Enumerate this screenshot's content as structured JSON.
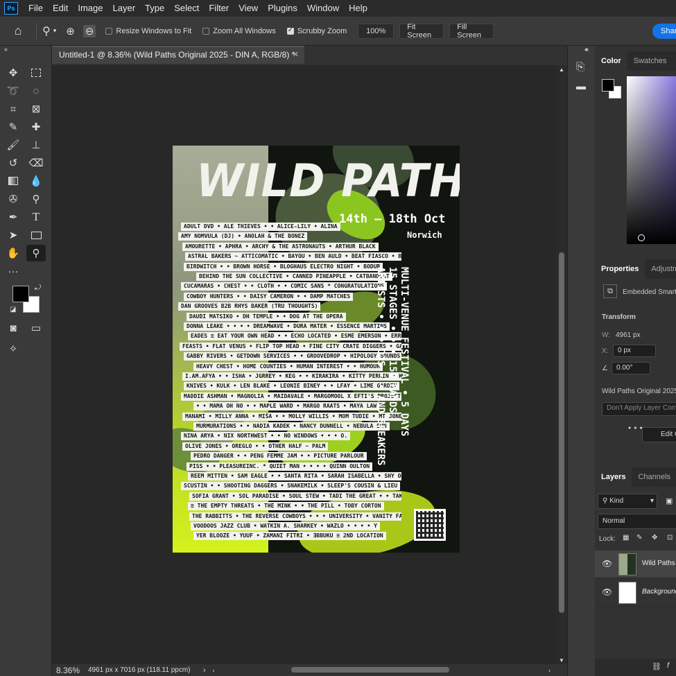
{
  "app": {
    "logo": "Ps"
  },
  "menu": [
    "File",
    "Edit",
    "Image",
    "Layer",
    "Type",
    "Select",
    "Filter",
    "View",
    "Plugins",
    "Window",
    "Help"
  ],
  "options": {
    "resize_windows": "Resize Windows to Fit",
    "zoom_all": "Zoom All Windows",
    "scrubby": "Scrubby Zoom",
    "zoom_value": "100%",
    "fit_screen": "Fit Screen",
    "fill_screen": "Fill Screen",
    "share": "Share"
  },
  "document": {
    "tab_title": "Untitled-1 @ 8.36% (Wild Paths Original 2025 - DIN A, RGB/8) *",
    "zoom": "8.36%",
    "dimensions": "4961 px x 7016 px (118.11 ppcm)"
  },
  "poster": {
    "title": "WILD PATHS",
    "dates": "14th – 18th Oct",
    "city": "Norwich",
    "side_text": "MULTI-VENUE FESTIVAL • 5 DAYS\n15 STAGES • • • 150 BANDS\nARTISTS • • • DJS • • AND SPEAKERS",
    "lineup": [
      "ADULT DVD • ALE THIEVES • • ALICE-LILY • ALINA",
      "AMY NOMVULA (DJ) • ANOLAH & THE BONEZ",
      "AMOURETTE • APHRA • ARCHY & THE ASTRONAUTS • ARTHUR BLACK",
      "ASTRAL BAKERS ~ ATTICOMATIC • BAYOU • BEN AULD • BEAT FIASCO • BINA.",
      "BIRDWITCH • • BROWN HORSE • BLOGHAUS ELECTRO NIGHT • BODUR",
      "BEHIND THE SUN COLLECTIVE • CANNED PINEAPPLE • CATBANDCAT",
      "CUCAMARAS • CHEST • • CLOTH • • COMIC SANS * CONGRATULATIONS",
      "COWBOY HUNTERS • • DAISY CAMERON • • DAMP MATCHES",
      "DAN GROOVES B2B RHYS BAKER (TRU THOUGHTS)",
      "DAUDI MATSIKO • DH TEMPLE • • DOG AT THE OPERA",
      "DONNA LEAKE • • • • DREAMWAVE • DURA MATER • ESSENCE MARTINS",
      "EADES ≡ EAT YOUR OWN HEAD • • ECHO LOCATED • ESME EMERSON • ERROL",
      "FEASTS • FLAT VENUS • FLIP TOP HEAD • FINE CITY CRATE DIGGERS • GALLUS",
      "GABBY RIVERS • GETDOWN SERVICES • • GROOVEDROP • HIPOLOGY SOUNDS",
      "HEAVY CHEST • HOME COUNTIES • HUMAN INTEREST • • HUMOUR",
      "I.AM.AFYA • • ISHA • JGRREY • KEG • • KIRAKIRA • KITTY PERRIN • KNATS",
      "KNIVES • KULK • LEN BLAKE • LEONIE BINEY • • LFAY • LIME GARDEN",
      "MADDIE ASHMAN • MAGNOLIA • MAIDAVALE • MARGOMOOL X EFTI'S PROJECT",
      "• • MAMA OH NO • • MAPLE WARD • MARGO RAATS • MAYA LAW",
      "MANAMI • MILLY ANNA • MIŠA • • MOLLY WILLIS • MOM TUDIE • MT JONES",
      "MURMURATIONS • • NADIA KADEK • NANCY DUNNELL • NEBULA SUN",
      "NINA ARYA • NIX NORTHWEST • • NO WINDOWS • • • O.",
      "OLIVE JONES • OREGLO • • OTHER HALF ~ PALM",
      "PEDRO DANGER • • PENG FEMME JAM • • PICTURE PARLOUR",
      "PISS • • PLEASUREINC. * QUIET MAN • • • • QUINN OULTON",
      "REEM MITTEN • SAM EAGLE • • SANTA RITA • SARAH ISABELLA • SHY ONE",
      "SCUSTIN • • SHOOTING DAGGERS • SNAKEMILK • SLEEP'S COUSIN & LIEU",
      "SOFIA GRANT • SOL PARADISE • SOUL STEW • TADI THE GREAT • • TAKEDA",
      "≡ THE EMPTY THREATS • THE MINK • • THE PILL • TOBY CORTON",
      "THE RABBITTS • THE REVERSE COWBOYS • • • UNIVERSITY • VANITY FAIRY",
      "VOODOOS JAZZ CLUB • WATKIN A. SHARKEY • WAZLO • • • • Y",
      "YER BLOOZE • YUUF • ZAMANI FITRI • ƎBBUKU ≡ 2ND LOCATION"
    ]
  },
  "right_panel": {
    "color_tabs": [
      "Color",
      "Swatches",
      "G"
    ],
    "props_tabs": [
      "Properties",
      "Adjustm"
    ],
    "embedded": "Embedded Smart",
    "transform_label": "Transform",
    "w_label": "W:",
    "w_value": "4961 px",
    "x_label": "X:",
    "x_value": "0 px",
    "angle": "0.00°",
    "layer_comp_name": "Wild Paths Original 2025",
    "layer_comp_dropdown": "Don't Apply Layer Com",
    "edit_btn": "Edit C",
    "layers_tabs": [
      "Layers",
      "Channels"
    ],
    "kind_filter": "Kind",
    "blend_mode": "Normal",
    "lock_label": "Lock:",
    "layers": [
      {
        "name": "Wild Paths",
        "italic": false
      },
      {
        "name": "Background",
        "italic": true
      }
    ]
  },
  "tools": [
    "move-icon",
    "marquee-icon",
    "lasso-icon",
    "quick-select-icon",
    "crop-icon",
    "frame-icon",
    "eyedropper-icon",
    "healing-icon",
    "brush-icon",
    "stamp-icon",
    "history-brush-icon",
    "eraser-icon",
    "gradient-icon",
    "blur-icon",
    "dodge-icon",
    "pen-icon",
    "type-icon",
    "path-select-icon",
    "rectangle-icon",
    "hand-icon",
    "zoom-icon"
  ]
}
